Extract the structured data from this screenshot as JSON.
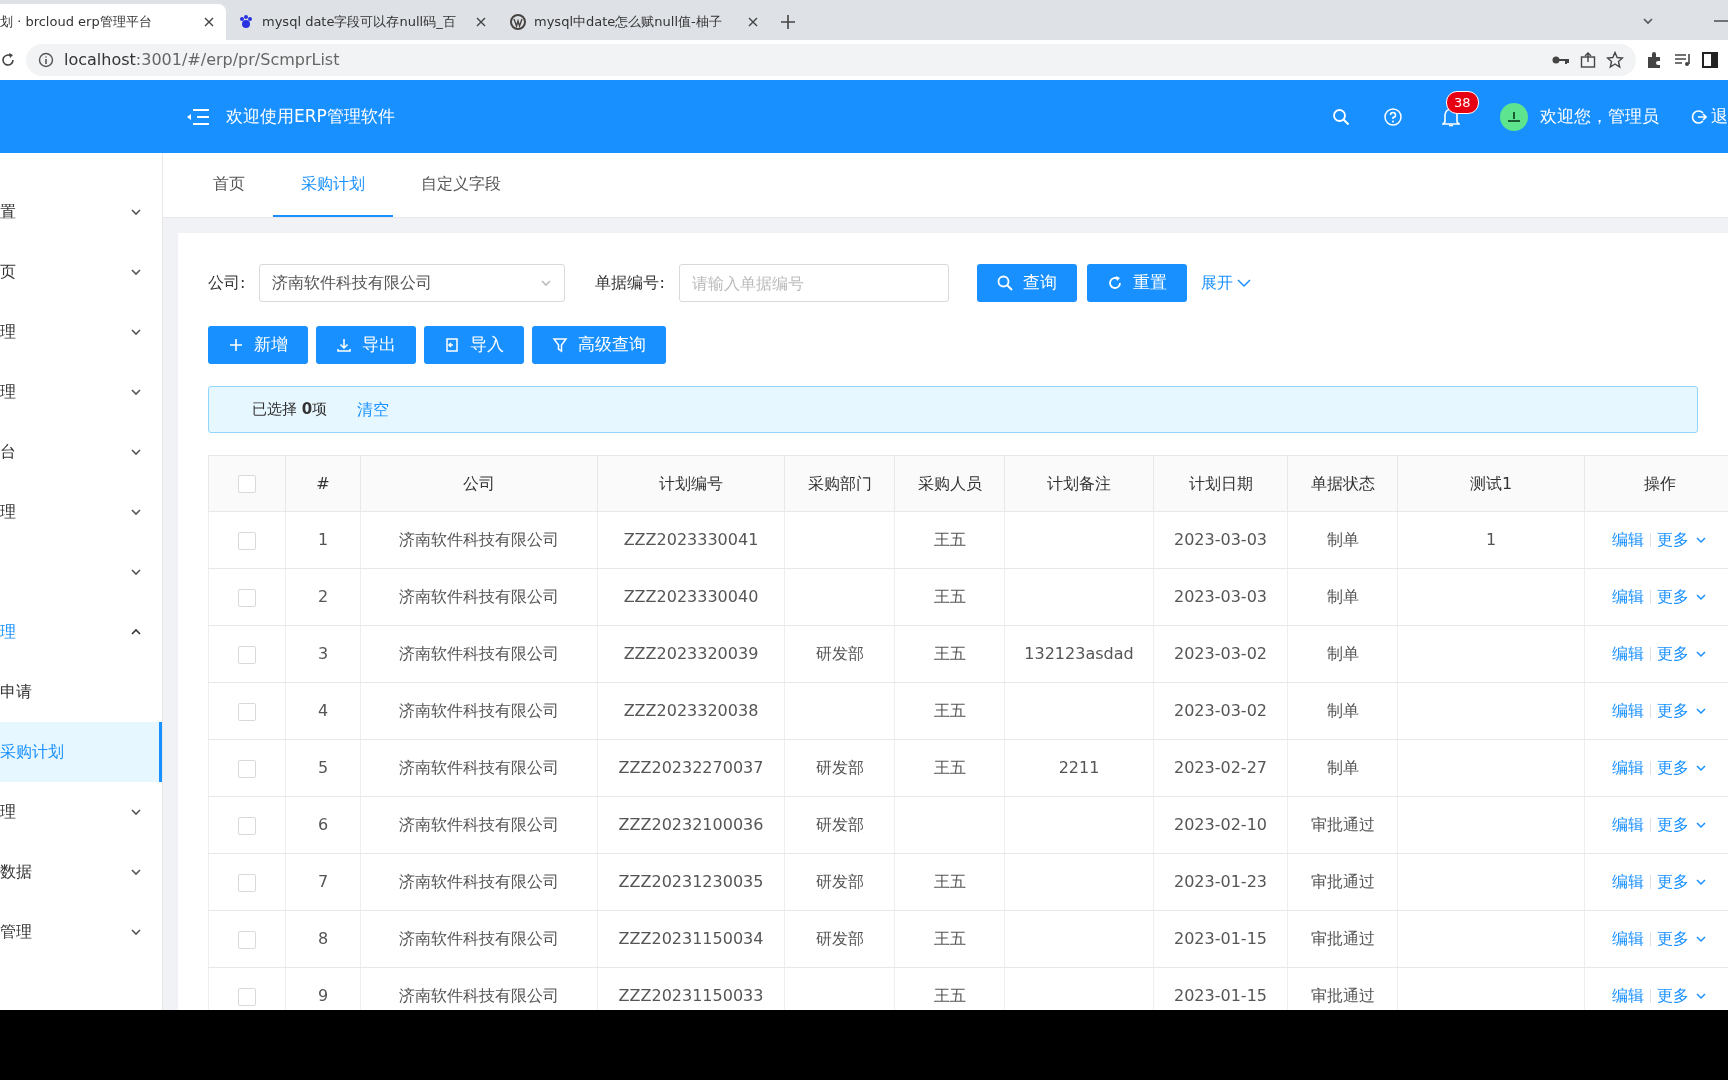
{
  "browser": {
    "tabs": [
      {
        "title": "划 · brcloud erp管理平台",
        "selected": true
      },
      {
        "title": "mysql date字段可以存null码_百",
        "selected": false
      },
      {
        "title": "mysql中date怎么赋null值-柚子",
        "selected": false
      }
    ],
    "address": {
      "host": "localhost",
      "path": ":3001/#/erp/pr/ScmprList"
    }
  },
  "app_header": {
    "title": "欢迎使用ERP管理软件",
    "notification_count": "38",
    "user": "欢迎您，管理员",
    "logout": "退"
  },
  "sidebar": {
    "items": [
      {
        "label": "置",
        "expanded": false
      },
      {
        "label": "页",
        "expanded": false
      },
      {
        "label": "理",
        "expanded": false
      },
      {
        "label": "理",
        "expanded": false
      },
      {
        "label": "台",
        "expanded": false
      },
      {
        "label": "理",
        "expanded": false
      },
      {
        "expanded": false
      },
      {
        "label": "理",
        "expanded": true,
        "children": [
          {
            "label": "申请",
            "selected": false
          },
          {
            "label": "采购计划",
            "selected": true
          }
        ]
      },
      {
        "label": "理",
        "expanded": false
      },
      {
        "label": "数据",
        "expanded": false
      },
      {
        "label": "管理",
        "expanded": false
      }
    ]
  },
  "page_tabs": [
    {
      "label": "首页",
      "selected": false
    },
    {
      "label": "采购计划",
      "selected": true
    },
    {
      "label": "自定义字段",
      "selected": false
    }
  ],
  "filters": {
    "company_label": "公司:",
    "company_value": "济南软件科技有限公司",
    "doc_label": "单据编号:",
    "doc_placeholder": "请输入单据编号",
    "query": "查询",
    "reset": "重置",
    "expand": "展开"
  },
  "actions": [
    {
      "label": "新增",
      "kind": "add"
    },
    {
      "label": "导出",
      "kind": "export"
    },
    {
      "label": "导入",
      "kind": "import"
    },
    {
      "label": "高级查询",
      "kind": "filter"
    }
  ],
  "selection": {
    "text": "已选择 **0**项",
    "clear": "清空"
  },
  "table": {
    "columns": [
      "#",
      "公司",
      "计划编号",
      "采购部门",
      "采购人员",
      "计划备注",
      "计划日期",
      "单据状态",
      "测试1",
      "操作"
    ],
    "all_checked": false,
    "rows": [
      {
        "checked": false,
        "cells": [
          "1",
          "济南软件科技有限公司",
          "ZZZ2023330041",
          "",
          "王五",
          "",
          "2023-03-03",
          "制单",
          "1"
        ],
        "actions": [
          "编辑",
          "更多"
        ]
      },
      {
        "checked": false,
        "cells": [
          "2",
          "济南软件科技有限公司",
          "ZZZ2023330040",
          "",
          "王五",
          "",
          "2023-03-03",
          "制单",
          ""
        ],
        "actions": [
          "编辑",
          "更多"
        ]
      },
      {
        "checked": false,
        "cells": [
          "3",
          "济南软件科技有限公司",
          "ZZZ2023320039",
          "研发部",
          "王五",
          "132123asdad",
          "2023-03-02",
          "制单",
          ""
        ],
        "actions": [
          "编辑",
          "更多"
        ]
      },
      {
        "checked": false,
        "cells": [
          "4",
          "济南软件科技有限公司",
          "ZZZ2023320038",
          "",
          "王五",
          "",
          "2023-03-02",
          "制单",
          ""
        ],
        "actions": [
          "编辑",
          "更多"
        ]
      },
      {
        "checked": false,
        "cells": [
          "5",
          "济南软件科技有限公司",
          "ZZZ20232270037",
          "研发部",
          "王五",
          "2211",
          "2023-02-27",
          "制单",
          ""
        ],
        "actions": [
          "编辑",
          "更多"
        ]
      },
      {
        "checked": false,
        "cells": [
          "6",
          "济南软件科技有限公司",
          "ZZZ20232100036",
          "研发部",
          "",
          "",
          "2023-02-10",
          "审批通过",
          ""
        ],
        "actions": [
          "编辑",
          "更多"
        ]
      },
      {
        "checked": false,
        "cells": [
          "7",
          "济南软件科技有限公司",
          "ZZZ20231230035",
          "研发部",
          "王五",
          "",
          "2023-01-23",
          "审批通过",
          ""
        ],
        "actions": [
          "编辑",
          "更多"
        ]
      },
      {
        "checked": false,
        "cells": [
          "8",
          "济南软件科技有限公司",
          "ZZZ20231150034",
          "研发部",
          "王五",
          "",
          "2023-01-15",
          "审批通过",
          ""
        ],
        "actions": [
          "编辑",
          "更多"
        ]
      },
      {
        "checked": false,
        "cells": [
          "9",
          "济南软件科技有限公司",
          "ZZZ20231150033",
          "",
          "王五",
          "",
          "2023-01-15",
          "审批通过",
          ""
        ],
        "actions": [
          "编辑",
          "更多"
        ]
      }
    ]
  }
}
